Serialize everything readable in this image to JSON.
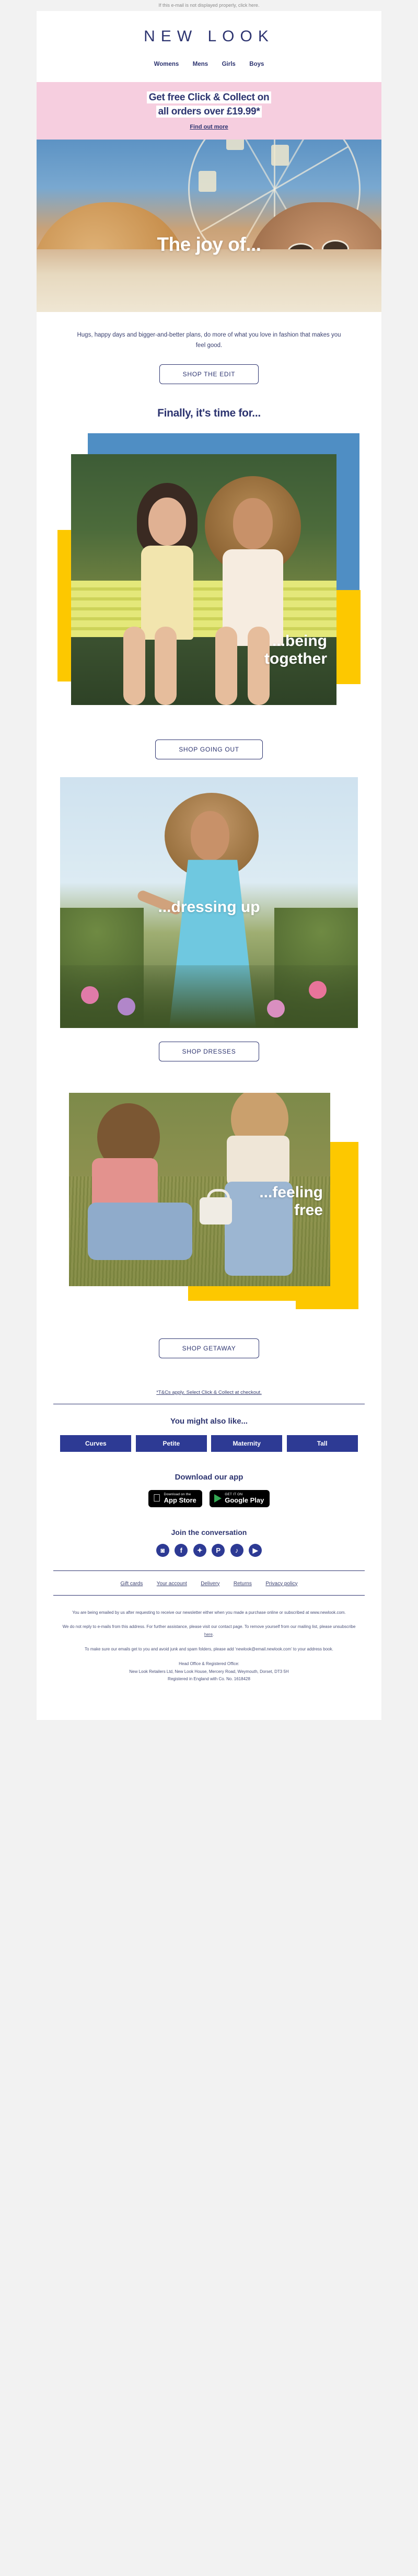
{
  "preheader": "If this e-mail is not displayed properly, click here.",
  "header": {
    "logo": "NEW LOOK",
    "nav": [
      {
        "label": "Womens"
      },
      {
        "label": "Mens"
      },
      {
        "label": "Girls"
      },
      {
        "label": "Boys"
      }
    ]
  },
  "promo": {
    "line1_a": "Get ",
    "line1_b": "free Click & Collect",
    "line1_c": " on",
    "line2": "all orders over £19.99*",
    "link": "Find out more",
    "bg": "#f6cedf",
    "text_color": "#2d3470"
  },
  "hero": {
    "caption": "The joy of...",
    "intro": "Hugs, happy days and bigger-and-better plans, do more of what you love in fashion that makes you feel good.",
    "cta": "SHOP THE EDIT"
  },
  "sections": [
    {
      "heading": "Finally, it's time for...",
      "caption_line1": "...being",
      "caption_line2": "together",
      "cta": "SHOP GOING OUT"
    },
    {
      "caption": "...dressing up",
      "cta": "SHOP DRESSES"
    },
    {
      "caption_line1": "...feeling",
      "caption_line2": "free",
      "cta": "SHOP GETAWAY"
    }
  ],
  "tcs": "*T&Cs apply. Select Click & Collect at checkout.",
  "also_like": {
    "heading": "You might also like...",
    "categories": [
      {
        "label": "Curves"
      },
      {
        "label": "Petite"
      },
      {
        "label": "Maternity"
      },
      {
        "label": "Tall"
      }
    ],
    "button_color": "#2d3a94"
  },
  "app": {
    "heading": "Download our app",
    "apple_small": "Download on the",
    "apple_big": "App Store",
    "google_small": "GET IT ON",
    "google_big": "Google Play"
  },
  "social": {
    "heading": "Join the conversation",
    "icons": [
      {
        "name": "instagram-icon",
        "glyph": "◙"
      },
      {
        "name": "facebook-icon",
        "glyph": "f"
      },
      {
        "name": "twitter-icon",
        "glyph": "✦"
      },
      {
        "name": "pinterest-icon",
        "glyph": "P"
      },
      {
        "name": "tiktok-icon",
        "glyph": "♪"
      },
      {
        "name": "youtube-icon",
        "glyph": "▶"
      }
    ]
  },
  "footer": {
    "links": [
      {
        "label": "Gift cards"
      },
      {
        "label": "Your account"
      },
      {
        "label": "Delivery"
      },
      {
        "label": "Returns"
      },
      {
        "label": "Privacy policy"
      }
    ],
    "legal1": "You are being emailed by us after requesting to receive our newsletter either when you made a purchase online or subscribed at www.newlook.com.",
    "legal2_a": "We do not reply to e-mails from this address. For further assistance, please visit our contact page. To remove yourself from our mailing list, please unsubscribe ",
    "legal2_link": "here",
    "legal2_b": ".",
    "legal3": "To make sure our emails get to you and avoid junk and spam folders, please add ‘newlook@email.newlook.com’ to your address book.",
    "addr1": "Head Office & Registered Office:",
    "addr2": "New Look Retailers Ltd, New Look House, Mercery Road, Weymouth, Dorset, DT3 5H",
    "addr3": "Registered in England with Co. No. 1618428"
  }
}
